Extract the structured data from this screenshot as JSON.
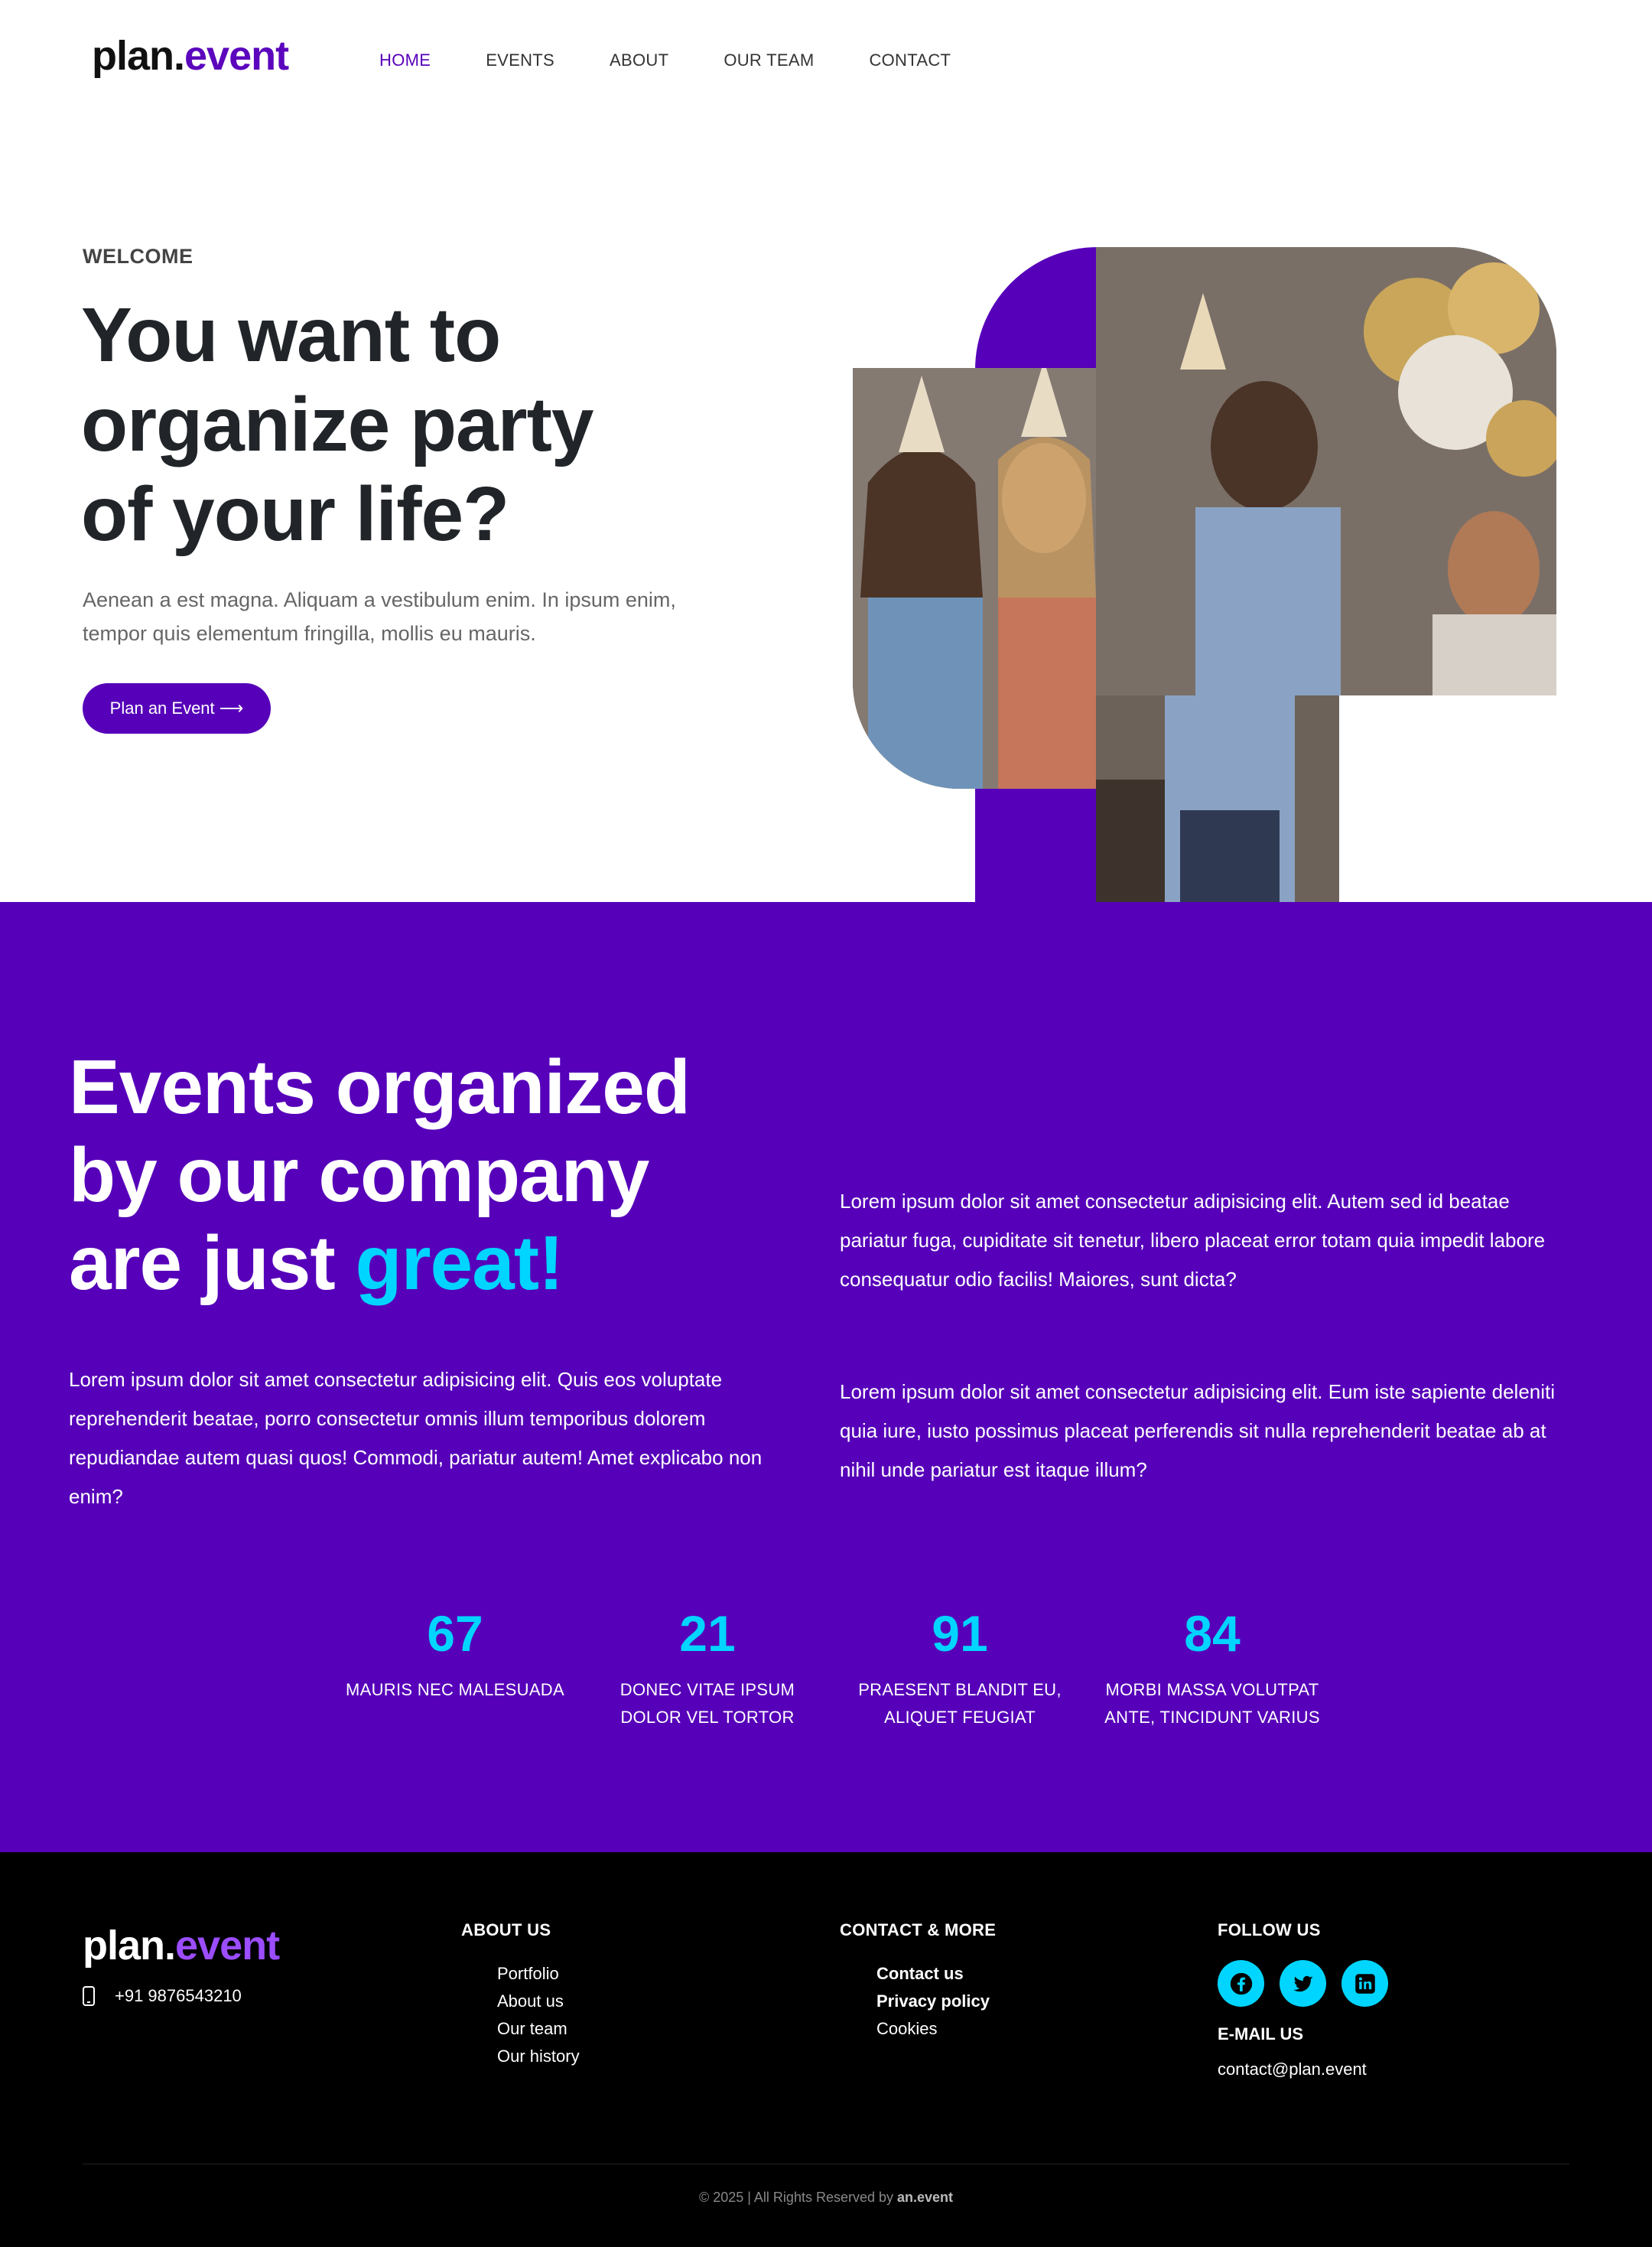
{
  "brand": {
    "part1": "plan.",
    "part2": "event"
  },
  "nav": {
    "items": [
      {
        "label": "HOME",
        "active": true
      },
      {
        "label": "EVENTS"
      },
      {
        "label": "ABOUT"
      },
      {
        "label": "OUR TEAM"
      },
      {
        "label": "CONTACT"
      }
    ]
  },
  "hero": {
    "eyebrow": "WELCOME",
    "title_line1": "You want to",
    "title_line2": "organize party",
    "title_line3": "of your life?",
    "text": "Aenean a est magna. Aliquam a vestibulum enim. In ipsum enim, tempor quis elementum fringilla, mollis eu mauris.",
    "button": "Plan an Event ⟶"
  },
  "about": {
    "title_line1": "Events organized",
    "title_line2": "by our company",
    "title_line3_a": "are just ",
    "title_line3_b": "great!",
    "text1": "Lorem ipsum dolor sit amet consectetur adipisicing elit. Autem sed id beatae pariatur fuga, cupiditate sit tenetur, libero placeat error totam quia impedit labore consequatur odio facilis! Maiores, sunt dicta?",
    "text2": "Lorem ipsum dolor sit amet consectetur adipisicing elit. Quis eos voluptate reprehenderit beatae, porro consectetur omnis illum temporibus dolorem repudiandae autem quasi quos! Commodi, pariatur autem! Amet explicabo non enim?",
    "text3": "Lorem ipsum dolor sit amet consectetur adipisicing elit. Eum iste sapiente deleniti quia iure, iusto possimus placeat perferendis sit nulla reprehenderit beatae ab at nihil unde pariatur est itaque illum?"
  },
  "stats": [
    {
      "number": "67",
      "line1": "MAURIS NEC MALESUADA",
      "line2": ""
    },
    {
      "number": "21",
      "line1": "DONEC VITAE IPSUM",
      "line2": "DOLOR VEL TORTOR"
    },
    {
      "number": "91",
      "line1": "PRAESENT BLANDIT EU,",
      "line2": "ALIQUET FEUGIAT"
    },
    {
      "number": "84",
      "line1": "MORBI MASSA VOLUTPAT",
      "line2": "ANTE, TINCIDUNT VARIUS"
    }
  ],
  "footer": {
    "phone": "+91 9876543210",
    "about_heading": "ABOUT US",
    "about_links": [
      "Portfolio",
      "About us",
      "Our team",
      "Our history"
    ],
    "contact_heading": "CONTACT & MORE",
    "contact_links": [
      "Contact us",
      "Privacy policy",
      "Cookies"
    ],
    "follow_heading": "FOLLOW US",
    "social": [
      "facebook-icon",
      "twitter-icon",
      "linkedin-icon"
    ],
    "email_heading": "E-MAIL US",
    "email": "contact@plan.event",
    "copyright_prefix": "© 2025 | All Rights Reserved by ",
    "copyright_brand": "an.event"
  },
  "colors": {
    "brand_purple": "#5600b9",
    "accent_cyan": "#00d5ff",
    "footer_bg": "#000000",
    "footer_logo_accent": "#9b4dff"
  }
}
